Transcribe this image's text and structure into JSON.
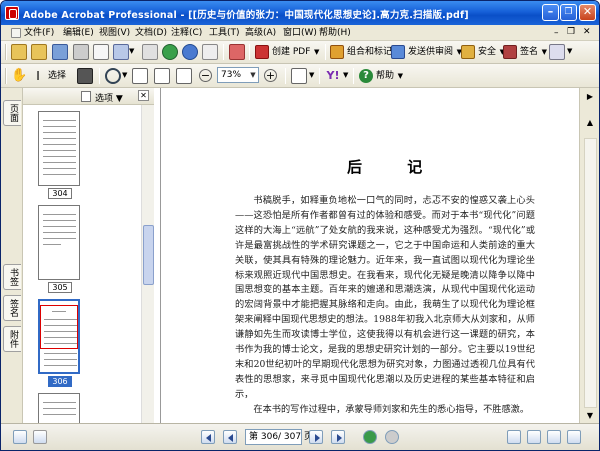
{
  "window": {
    "title": "Adobe Acrobat Professional - [[历史与价值的张力：中国现代化思想史论].高力克.扫描版.pdf]",
    "controls": [
      "minimize",
      "restore",
      "close"
    ],
    "mdi_controls": [
      "minimize",
      "restore",
      "close"
    ]
  },
  "menu": {
    "items": [
      {
        "label": "文件(F)"
      },
      {
        "label": "编辑(E)"
      },
      {
        "label": "视图(V)"
      },
      {
        "label": "文档(D)"
      },
      {
        "label": "注释(C)"
      },
      {
        "label": "工具(T)"
      },
      {
        "label": "高级(A)"
      },
      {
        "label": "窗口(W)"
      },
      {
        "label": "帮助(H)"
      }
    ]
  },
  "toolbar1": {
    "create_pdf": "创建 PDF",
    "combine": "组合和标记",
    "send_review": "发送供审阅",
    "secure": "安全",
    "sign": "签名"
  },
  "toolbar2": {
    "select_label": "选择",
    "zoom_value": "73%",
    "help_label": "帮助"
  },
  "nav_tabs": [
    "页面",
    "书签",
    "签名",
    "附件"
  ],
  "panel": {
    "options_label": "选项",
    "thumbnails": [
      {
        "page": "304",
        "selected": false
      },
      {
        "page": "305",
        "selected": false
      },
      {
        "page": "306",
        "selected": true
      },
      {
        "page": "307",
        "selected": false
      }
    ]
  },
  "document": {
    "heading": "后 记",
    "paragraphs": [
      "书稿脱手，如释重负地松一口气的同时，忐忑不安的惶惑又袭上心头——这恐怕是所有作者都曾有过的体验和感受。而对于本书“现代化”问题这样的大海上“远航”了处女航的我来说，这种感受尤为强烈。“现代化”或许是最富挑战性的学术研究课题之一，它之于中国命运和人类前途的重大关联，使其具有特殊的理论魅力。近年来，我一直试图以现代化为理论坐标来观照近现代中国思想史。在我看来，现代化无疑是晚清以降争以降中国思想变的基本主题。百年来的嬗递和思潮迭演，从现代中国现代化运动的宏阔背景中才能把握其脉络和走向。由此，我萌生了以现代化为理论框架来阐释中国现代思想史的想法。1988年初我入北京师大从刘家和，从师谦静如先生而攻读博士学位，这使我得以有机会进行这一课题的研究，本书作为我的博士论文，是我的思想史研究计划的一部分。它主要以19世纪末和20世纪初叶的早期现代化思想为研究对象，力图通过透视几位具有代表性的思想家，来寻觅中国现代化思潮以及历史进程的某些基本特征和启示，",
      "在本书的写作过程中，承蒙导师刘家和先生的悉心指导，不胜感激。"
    ]
  },
  "statusbar": {
    "page_display": "第 306/ 307 页"
  }
}
